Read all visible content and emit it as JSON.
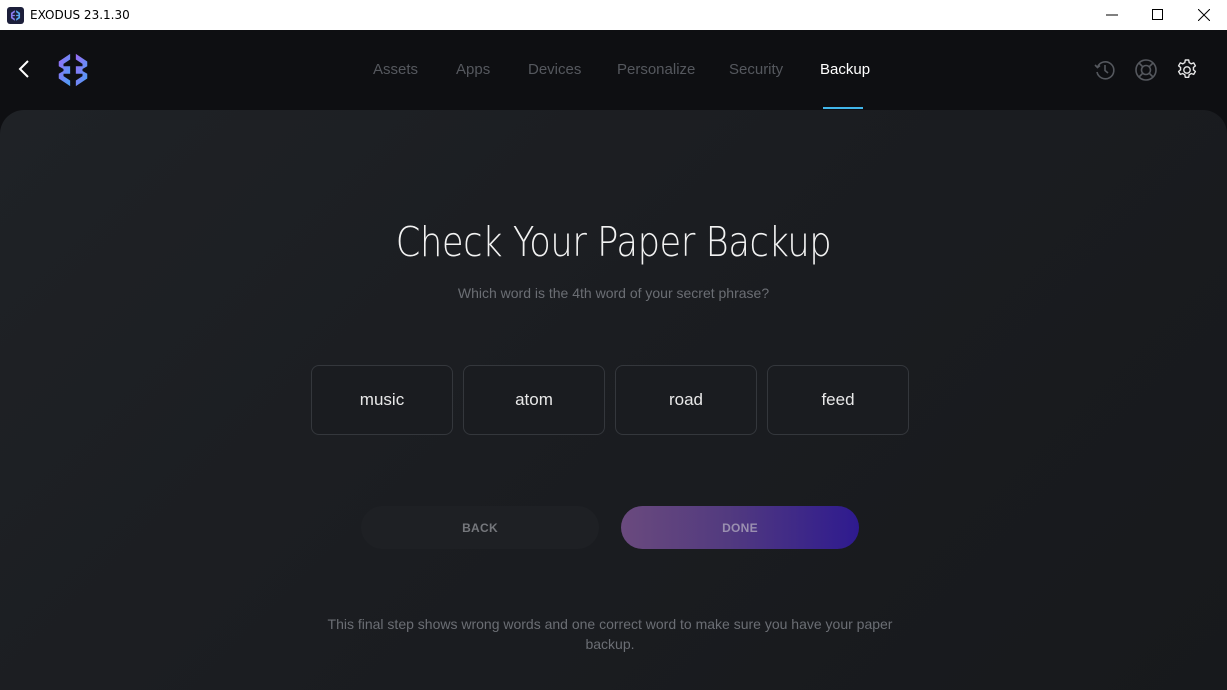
{
  "window": {
    "title": "EXODUS 23.1.30",
    "controls": [
      "minimize",
      "maximize",
      "close"
    ]
  },
  "nav": {
    "back_icon": "chevron-left-icon",
    "logo": "exodus-logo",
    "tabs": [
      {
        "label": "Assets",
        "active": false
      },
      {
        "label": "Apps",
        "active": false
      },
      {
        "label": "Devices",
        "active": false
      },
      {
        "label": "Personalize",
        "active": false
      },
      {
        "label": "Security",
        "active": false
      },
      {
        "label": "Backup",
        "active": true
      }
    ],
    "right_icons": [
      "history-icon",
      "lifebuoy-icon",
      "gear-icon"
    ],
    "accent_color": "#41b6ea"
  },
  "main": {
    "title": "Check Your Paper Backup",
    "question": "Which word is the 4th word of your secret phrase?",
    "word_options": [
      "music",
      "atom",
      "road",
      "feed"
    ],
    "back_button": "BACK",
    "done_button": "DONE",
    "footnote": "This final step shows wrong words and one correct word to make sure you have your paper backup."
  }
}
